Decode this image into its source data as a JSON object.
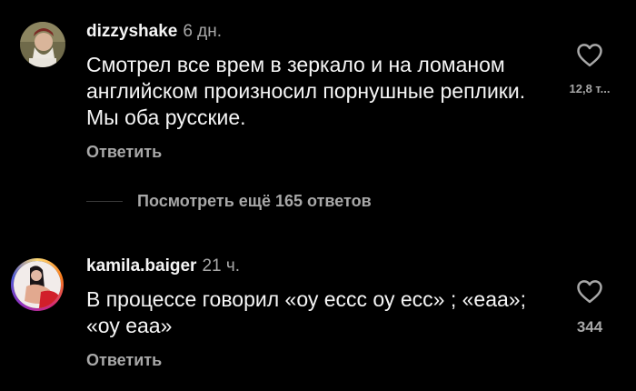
{
  "comments": [
    {
      "username": "dizzyshake",
      "time": "6 дн.",
      "text": "Смотрел все врем в зеркало и на ломаном английском произносил порнушные реплики. Мы оба русские.",
      "reply_label": "Ответить",
      "likes": "12,8 т...",
      "like_icon": "heart-outline-icon"
    },
    {
      "username": "kamila.baiger",
      "time": "21 ч.",
      "text": "В процессе говорил «оу еccc оу есс» ; «еаа»; «оу еаа»",
      "reply_label": "Ответить",
      "likes": "344",
      "like_icon": "heart-outline-icon"
    }
  ],
  "thread": {
    "view_more_label": "Посмотреть ещё 165 ответов"
  },
  "colors": {
    "background": "#000000",
    "primary_text": "#f5f5f5",
    "secondary_text": "#a8a8a8"
  }
}
